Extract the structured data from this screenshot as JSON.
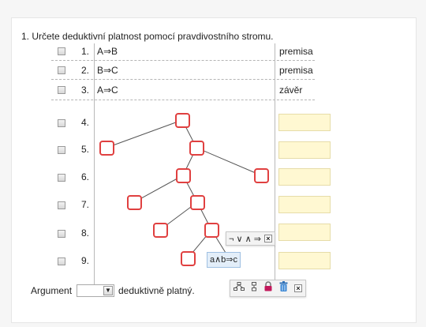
{
  "task": "1. Určete deduktivní platnost pomocí pravdivostního stromu.",
  "premise_rows": [
    {
      "number": "1.",
      "formula": "A⇒B",
      "note": "premisa"
    },
    {
      "number": "2.",
      "formula": "B⇒C",
      "note": "premisa"
    },
    {
      "number": "3.",
      "formula": "A⇒C",
      "note": "závěr"
    }
  ],
  "tree_rows": [
    {
      "number": "4."
    },
    {
      "number": "5."
    },
    {
      "number": "6."
    },
    {
      "number": "7."
    },
    {
      "number": "8."
    },
    {
      "number": "9."
    }
  ],
  "connective_toolbar": {
    "symbols": "¬ ∨ ∧ ⇒",
    "close": "×"
  },
  "formula_chip": "a∧b⇒c",
  "node_toolbar": {
    "icons": [
      "tree-icon",
      "split-icon",
      "lock-icon",
      "trash-icon"
    ],
    "close": "×"
  },
  "argument": {
    "prefix": "Argument",
    "select_value": "",
    "suffix": "deduktivně platný."
  },
  "colors": {
    "node_border": "#e04040",
    "answer_fill": "#fff8d2",
    "chip_fill": "#e3eef9"
  }
}
